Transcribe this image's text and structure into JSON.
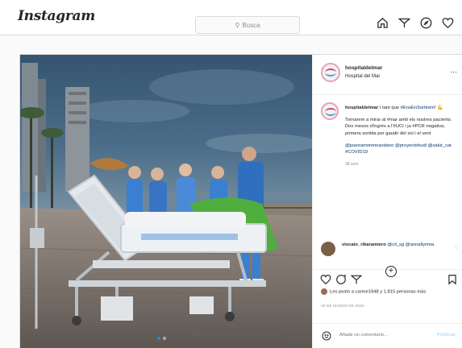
{
  "header": {
    "logo": "Instagram",
    "search_placeholder": "Busca",
    "icons": [
      "home-icon",
      "direct-icon",
      "explore-icon",
      "heart-icon"
    ]
  },
  "post": {
    "username": "hospitaldelmar",
    "location": "Hospital del Mar",
    "caption": {
      "line1_user": "hospitaldelmar",
      "line1_text": "I tant que",
      "line1_tag": "#EnsEnSortirem!",
      "line1_emoji": "💪",
      "para2": "Tornarem a mirar al #mar amb els nostres pacients. Dos mesos d'ingrés a l'#UCI i ja #PCR negativa, primera sortida per gaudir del sol i el vent",
      "para3": "@joanramonmiravdano @proyectohudi @salut_cat #COVID19",
      "time": "38 sem"
    },
    "comment": {
      "user": "vivcato_rikaramiero",
      "text": "@cil_sg @annallyrima"
    },
    "likes_text": "Les posto a carme1948 y 1.815 personas más",
    "date": "18 DE MARZO DE 2020",
    "add_comment_placeholder": "Añade un comentario...",
    "post_button": "Publicar",
    "slide_count": 2,
    "active_slide": 1
  },
  "colors": {
    "accent": "#0095f6",
    "border": "#dbdbdb",
    "scrubs": "#3b7fd0",
    "sky": "#2f5272"
  }
}
